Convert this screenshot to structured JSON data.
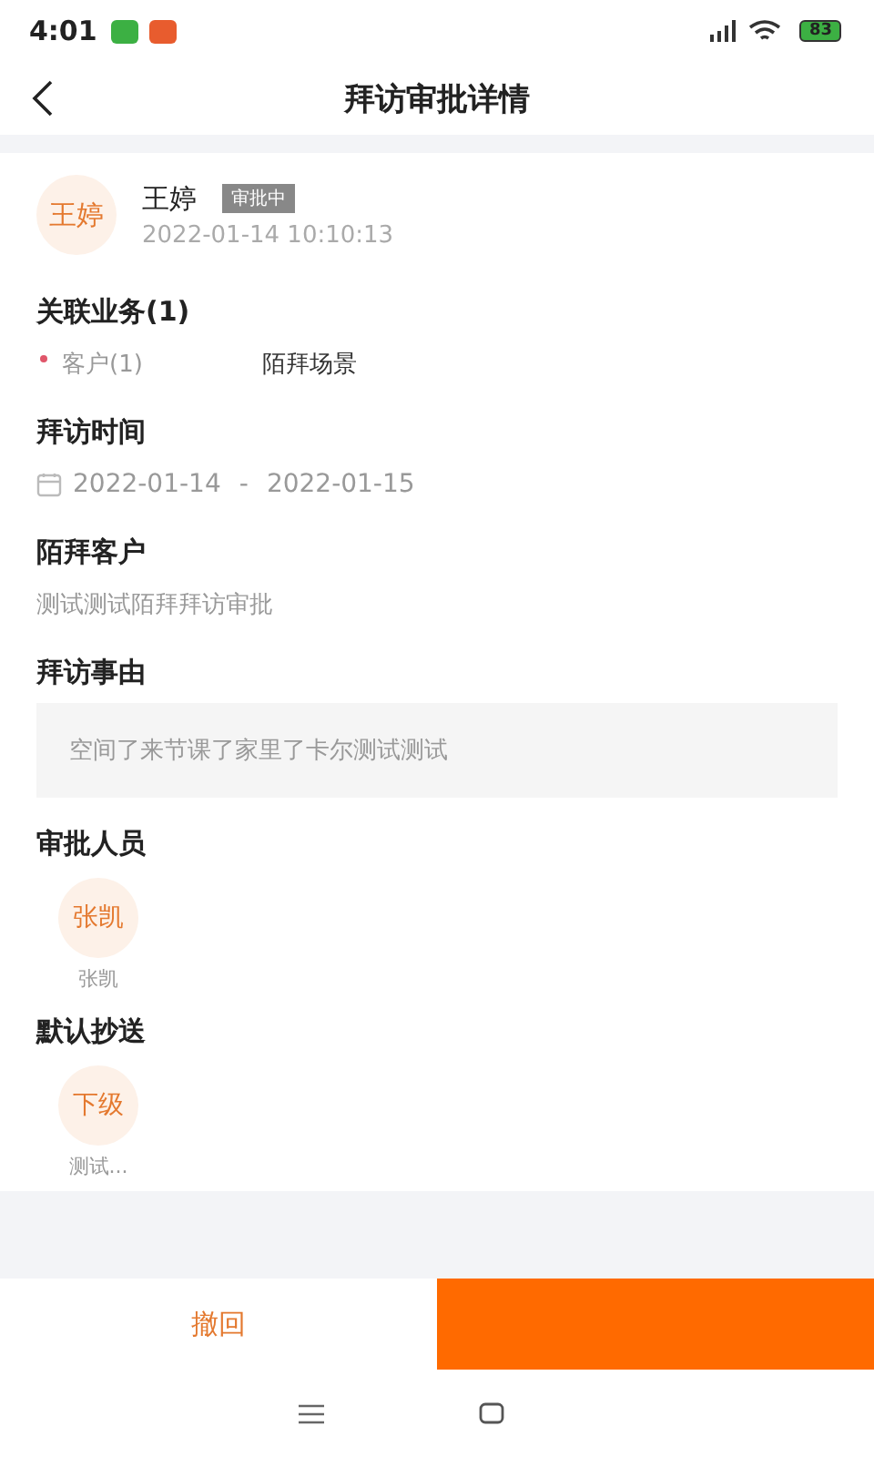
{
  "status_bar": {
    "time": "4:01",
    "battery": "83"
  },
  "header": {
    "title": "拜访审批详情"
  },
  "applicant": {
    "avatar": "王婷",
    "name": "王婷",
    "status": "审批中",
    "time": "2022-01-14 10:10:13"
  },
  "related": {
    "title": "关联业务(1)",
    "required": true,
    "label": "客户(1)",
    "value": "陌拜场景"
  },
  "visit_time": {
    "title": "拜访时间",
    "start": "2022-01-14",
    "separator": "-",
    "end": "2022-01-15"
  },
  "customer": {
    "title": "陌拜客户",
    "value": "测试测试陌拜拜访审批"
  },
  "reason": {
    "title": "拜访事由",
    "value": "空间了来节课了家里了卡尔测试测试"
  },
  "sections": [
    {
      "title": "审批人员",
      "people": [
        {
          "avatar": "张凯",
          "name": "张凯"
        }
      ]
    },
    {
      "title": "默认抄送",
      "people": [
        {
          "avatar": "下级",
          "name": "测试..."
        }
      ]
    }
  ],
  "footer": {
    "withdraw": "撤回"
  }
}
